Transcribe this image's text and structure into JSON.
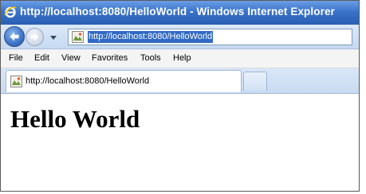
{
  "window": {
    "title": "http://localhost:8080/HelloWorld - Windows Internet Explorer"
  },
  "navigation": {
    "address": "http://localhost:8080/HelloWorld"
  },
  "menu": {
    "items": [
      "File",
      "Edit",
      "View",
      "Favorites",
      "Tools",
      "Help"
    ]
  },
  "tabs": [
    {
      "label": "http://localhost:8080/HelloWorld"
    }
  ],
  "content": {
    "heading": "Hello World"
  },
  "colors": {
    "titlebar": "#3a73c9",
    "selection": "#316ac5"
  },
  "icons": [
    "ie-logo-icon",
    "back-arrow-icon",
    "forward-arrow-icon",
    "dropdown-arrow-icon",
    "page-icon"
  ]
}
